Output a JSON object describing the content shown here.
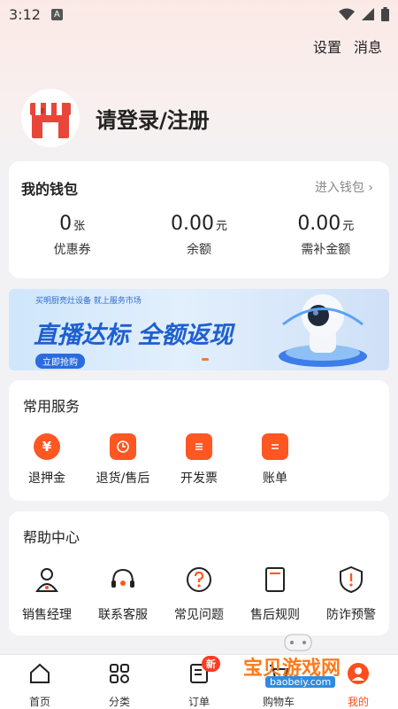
{
  "status_bar": {
    "time": "3:12",
    "notification_letter": "A"
  },
  "header": {
    "settings_label": "设置",
    "messages_label": "消息"
  },
  "profile": {
    "login_label": "请登录/注册"
  },
  "wallet": {
    "title": "我的钱包",
    "enter_label": "进入钱包 ›",
    "items": [
      {
        "value": "0",
        "unit": "张",
        "label": "优惠券"
      },
      {
        "value": "0.00",
        "unit": "元",
        "label": "余额"
      },
      {
        "value": "0.00",
        "unit": "元",
        "label": "需补金额"
      }
    ]
  },
  "banner": {
    "small_text": "买明厨亮灶设备 就上服务市场",
    "main_text": "直播达标 全额返现",
    "button_label": "立即抢购"
  },
  "services": {
    "title": "常用服务",
    "items": [
      {
        "label": "退押金",
        "icon": "yen-icon"
      },
      {
        "label": "退货/售后",
        "icon": "return-icon"
      },
      {
        "label": "开发票",
        "icon": "invoice-icon"
      },
      {
        "label": "账单",
        "icon": "bill-icon"
      }
    ]
  },
  "help": {
    "title": "帮助中心",
    "items": [
      {
        "label": "销售经理",
        "icon": "person-icon"
      },
      {
        "label": "联系客服",
        "icon": "headset-icon"
      },
      {
        "label": "常见问题",
        "icon": "question-icon"
      },
      {
        "label": "售后规则",
        "icon": "document-icon"
      },
      {
        "label": "防诈预警",
        "icon": "warning-shield-icon"
      }
    ]
  },
  "tabbar": {
    "items": [
      {
        "label": "首页",
        "icon": "home-icon"
      },
      {
        "label": "分类",
        "icon": "category-icon"
      },
      {
        "label": "订单",
        "icon": "order-icon"
      },
      {
        "label": "购物车",
        "icon": "cart-icon"
      },
      {
        "label": "我的",
        "icon": "profile-icon"
      }
    ],
    "order_badge": "新"
  },
  "watermark": {
    "text": "宝贝游戏网",
    "url": "baobeiy.com"
  },
  "colors": {
    "accent": "#ff5722",
    "banner_blue": "#1e5fd0"
  }
}
